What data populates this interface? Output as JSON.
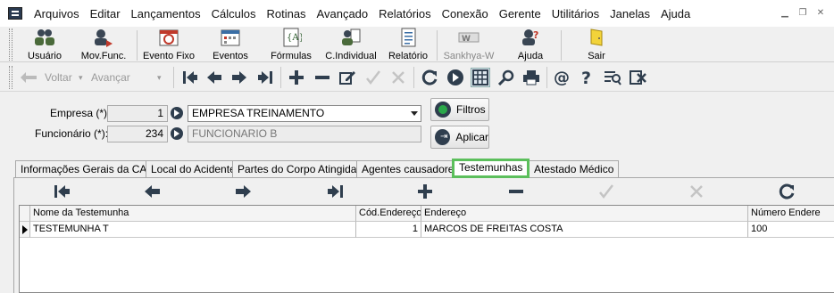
{
  "menu": {
    "items": [
      "Arquivos",
      "Editar",
      "Lançamentos",
      "Cálculos",
      "Rotinas",
      "Avançado",
      "Relatórios",
      "Conexão",
      "Gerente",
      "Utilitários",
      "Janelas",
      "Ajuda"
    ]
  },
  "toolbar": {
    "buttons": [
      {
        "label": "Usuário",
        "icon": "users-icon"
      },
      {
        "label": "Mov.Func.",
        "icon": "employee-movement-icon"
      },
      {
        "label": "Evento Fixo",
        "icon": "fixed-event-icon"
      },
      {
        "label": "Eventos",
        "icon": "events-calendar-icon"
      },
      {
        "label": "Fórmulas",
        "icon": "formula-icon"
      },
      {
        "label": "C.Individual",
        "icon": "individual-card-icon"
      },
      {
        "label": "Relatório",
        "icon": "report-icon"
      },
      {
        "label": "Sankhya-W",
        "icon": "sankhya-logo-icon"
      },
      {
        "label": "Ajuda",
        "icon": "help-icon"
      },
      {
        "label": "Sair",
        "icon": "exit-door-icon"
      }
    ]
  },
  "nav": {
    "back_label": "Voltar",
    "forward_label": "Avançar"
  },
  "form": {
    "empresa_label": "Empresa (*):",
    "empresa_code": "1",
    "empresa_name": "EMPRESA TREINAMENTO",
    "funcionario_label": "Funcionário (*):",
    "funcionario_code": "234",
    "funcionario_name": "FUNCIONARIO B",
    "filtros_label": "Filtros",
    "aplicar_label": "Aplicar"
  },
  "tabs": [
    {
      "label": "Informações Gerais da CAT",
      "active": false
    },
    {
      "label": "Local do Acidente",
      "active": false
    },
    {
      "label": "Partes do Corpo Atingidas",
      "active": false
    },
    {
      "label": "Agentes causadores",
      "active": false
    },
    {
      "label": "Testemunhas",
      "active": true
    },
    {
      "label": "Atestado Médico",
      "active": false
    }
  ],
  "grid": {
    "columns": [
      "Nome da Testemunha",
      "Cód.Endereço",
      "Endereço",
      "Número Endere"
    ],
    "rows": [
      {
        "nome": "TESTEMUNHA T",
        "cod_endereco": "1",
        "endereco": "MARCOS DE FREITAS COSTA",
        "numero": "100"
      }
    ]
  },
  "colors": {
    "active_tab_border": "#5cbf5c",
    "icon_dark": "#2f3e4e",
    "filtros_green": "#2aa84a"
  }
}
